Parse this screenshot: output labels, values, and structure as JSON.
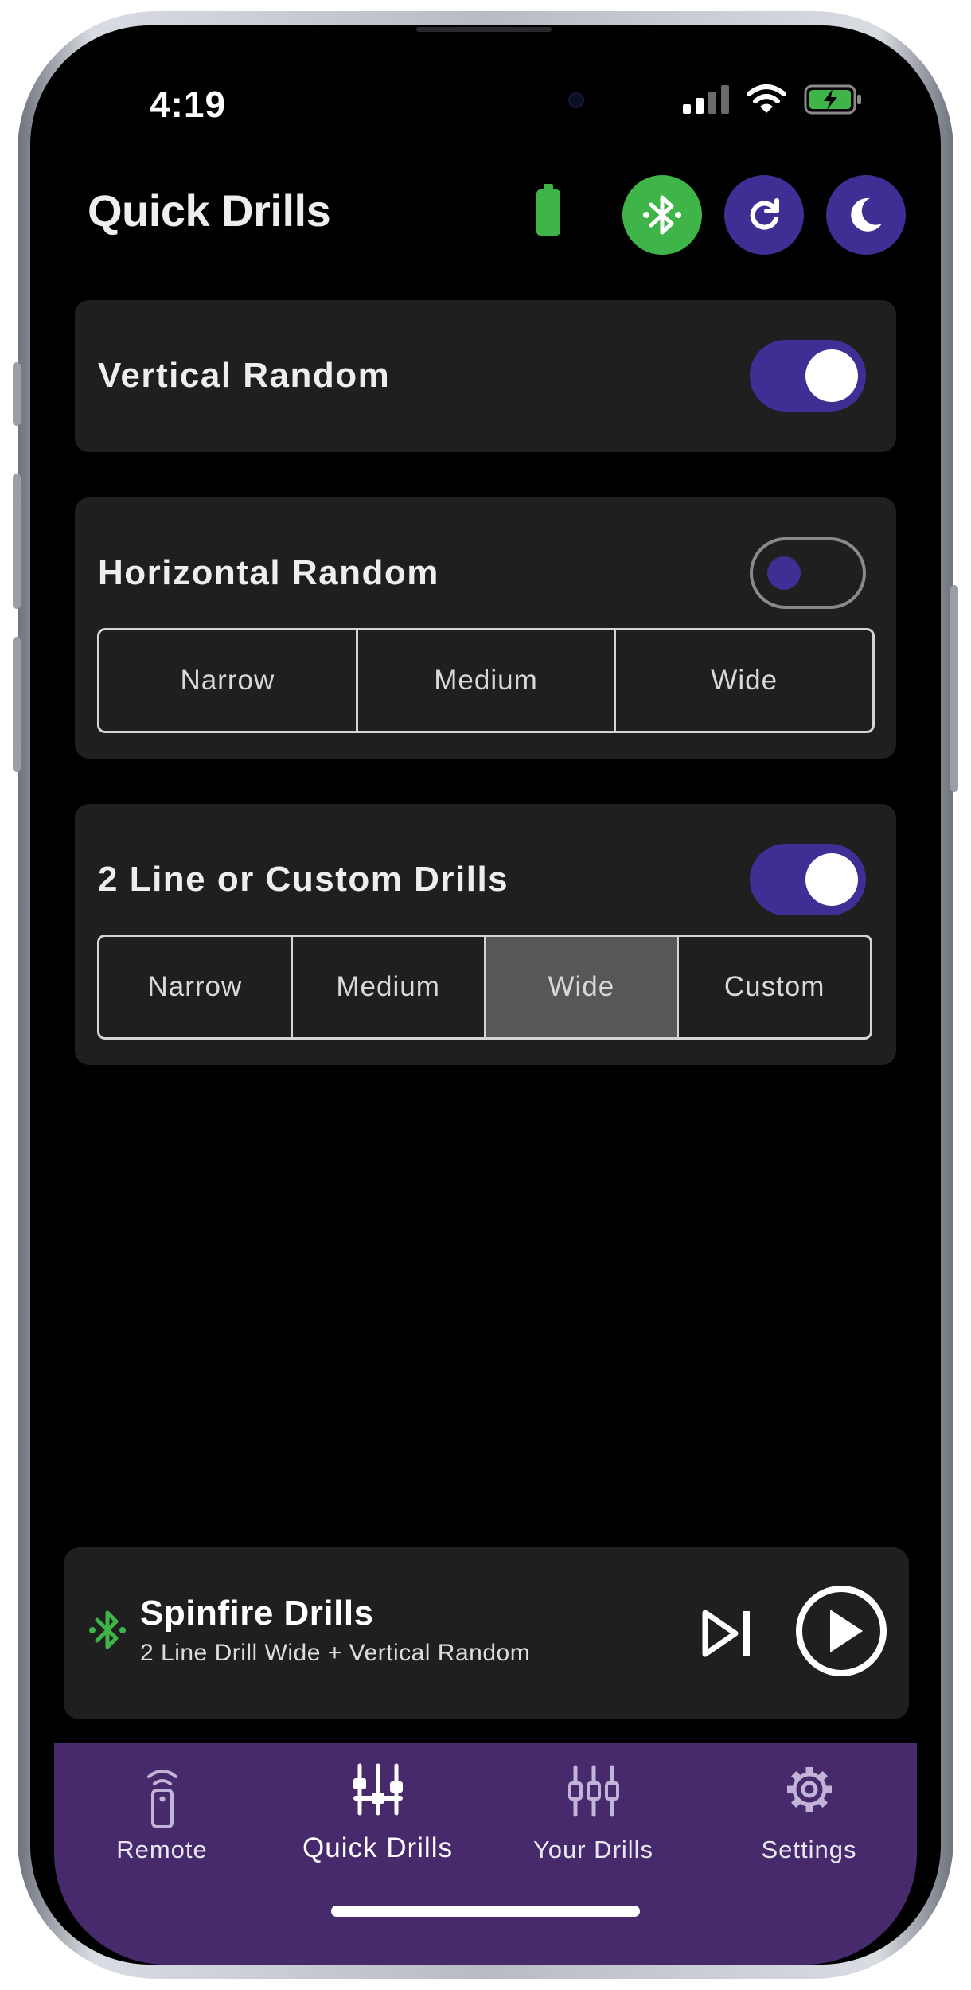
{
  "status_bar": {
    "time": "4:19"
  },
  "header": {
    "title": "Quick Drills"
  },
  "colors": {
    "accent": "#3f2f95",
    "bluetooth_connected": "#3fb449",
    "tab_bar": "#472a6c",
    "card": "#1f1f20"
  },
  "cards": [
    {
      "label": "Vertical Random",
      "toggle_on": true
    },
    {
      "label": "Horizontal Random",
      "toggle_on": false,
      "options": [
        "Narrow",
        "Medium",
        "Wide"
      ]
    },
    {
      "label": "2 Line or Custom Drills",
      "toggle_on": true,
      "options": [
        "Narrow",
        "Medium",
        "Wide",
        "Custom"
      ],
      "selected": "Wide"
    }
  ],
  "player": {
    "title": "Spinfire Drills",
    "subtitle": "2 Line Drill Wide + Vertical Random"
  },
  "tabs": [
    {
      "label": "Remote",
      "icon": "remote-icon"
    },
    {
      "label": "Quick Drills",
      "icon": "sliders-icon",
      "active": true
    },
    {
      "label": "Your Drills",
      "icon": "sliders-icon"
    },
    {
      "label": "Settings",
      "icon": "gear-icon"
    }
  ]
}
